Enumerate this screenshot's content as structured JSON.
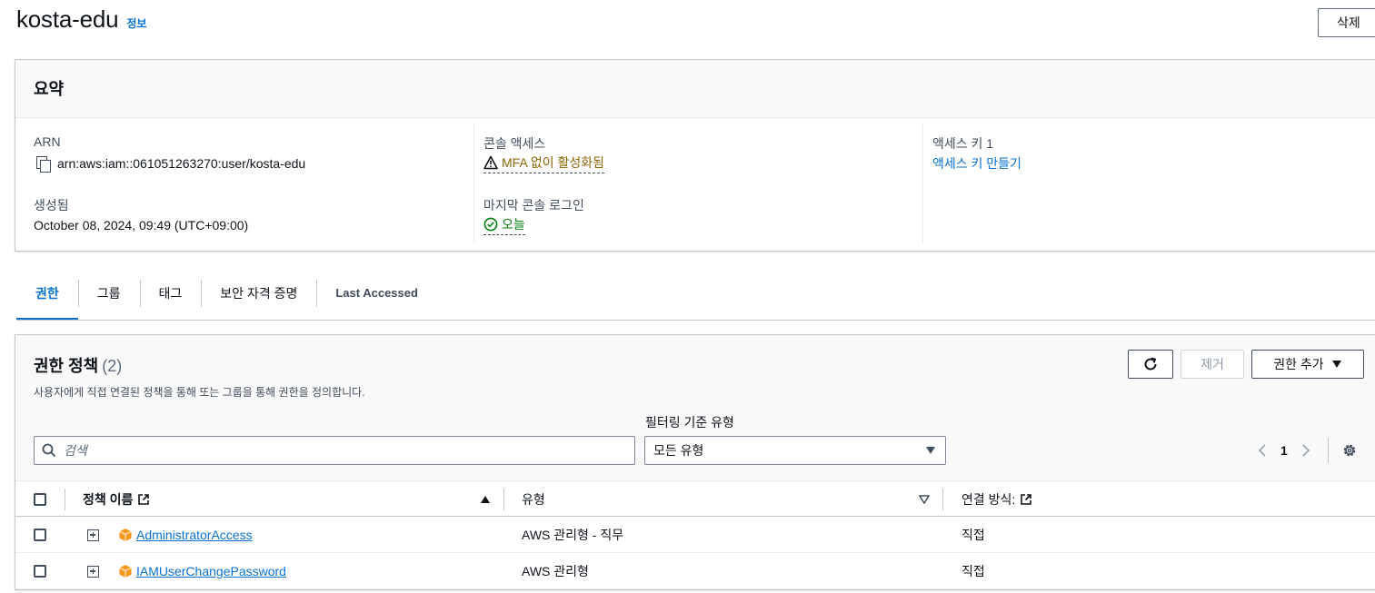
{
  "header": {
    "title": "kosta-edu",
    "info_label": "정보",
    "delete_label": "삭제"
  },
  "summary": {
    "title": "요약",
    "arn_label": "ARN",
    "arn_value": "arn:aws:iam::061051263270:user/kosta-edu",
    "created_label": "생성됨",
    "created_value": "October 08, 2024, 09:49 (UTC+09:00)",
    "console_access_label": "콘솔 액세스",
    "console_access_value": "MFA 없이 활성화됨",
    "last_login_label": "마지막 콘솔 로그인",
    "last_login_value": "오늘",
    "access_key_label": "액세스 키 1",
    "access_key_link": "액세스 키 만들기"
  },
  "tabs": [
    {
      "label": "권한",
      "active": true
    },
    {
      "label": "그룹"
    },
    {
      "label": "태그"
    },
    {
      "label": "보안 자격 증명"
    },
    {
      "label": "Last Accessed"
    }
  ],
  "policies": {
    "title": "권한 정책",
    "count": "(2)",
    "description": "사용자에게 직접 연결된 정책을 통해 또는 그룹을 통해 권한을 정의합니다.",
    "remove_label": "제거",
    "add_label": "권한 추가",
    "filter_label": "필터링 기준 유형",
    "search_placeholder": "검색",
    "type_selected": "모든 유형",
    "page": "1",
    "columns": {
      "name": "정책 이름",
      "type": "유형",
      "attach": "연결 방식:"
    },
    "rows": [
      {
        "name": "AdministratorAccess",
        "type": "AWS 관리형 - 직무",
        "attach": "직접"
      },
      {
        "name": "IAMUserChangePassword",
        "type": "AWS 관리형",
        "attach": "직접"
      }
    ]
  },
  "colors": {
    "link": "#0972d3",
    "warning": "#8d6605",
    "success": "#037f0c",
    "policy_icon": "#f8991d"
  },
  "icons": [
    "copy-icon",
    "warning-icon",
    "check-circle-icon",
    "refresh-icon",
    "caret-down-icon",
    "search-icon",
    "chevron-left-icon",
    "chevron-right-icon",
    "gear-icon",
    "external-link-icon",
    "sort-ascending-icon",
    "sort-descending-icon",
    "expand-icon",
    "policy-cube-icon"
  ]
}
